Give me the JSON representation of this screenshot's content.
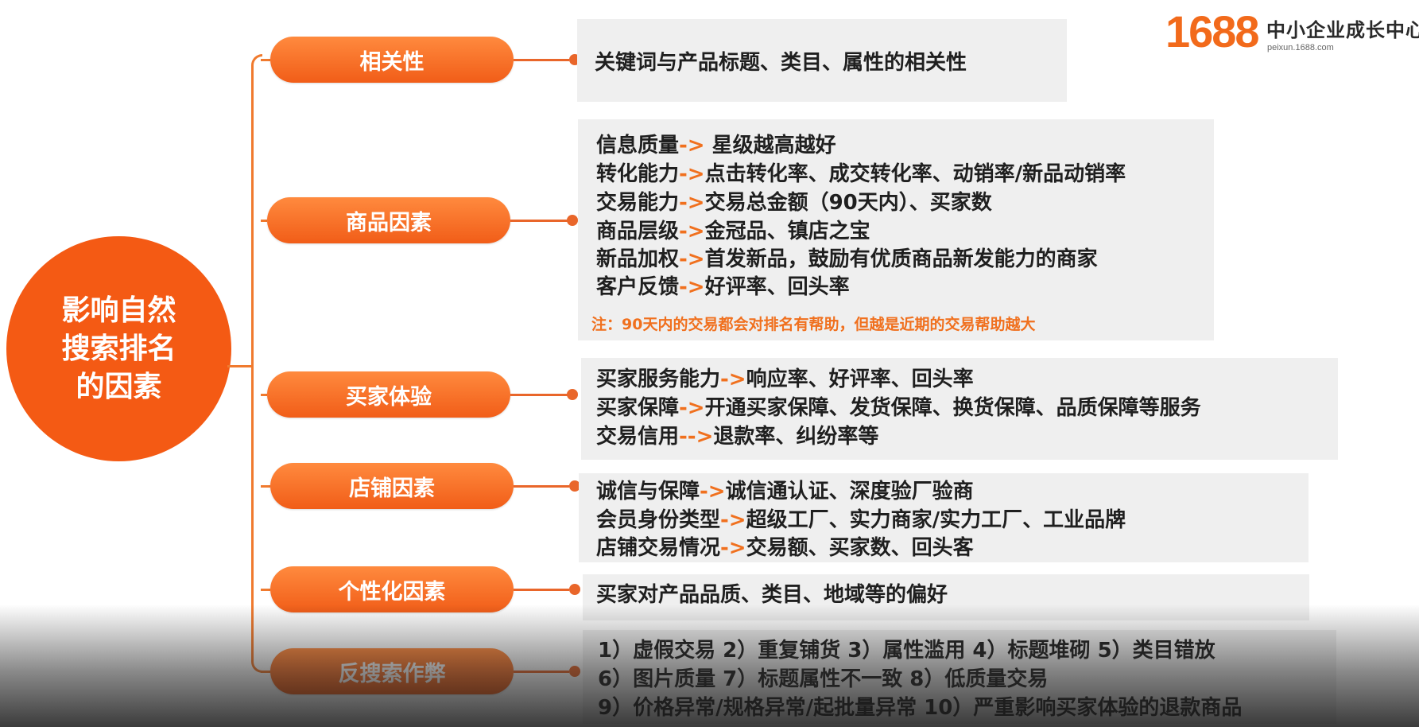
{
  "logo": {
    "number": "1688",
    "title": "中小企业成长中心",
    "url": "peixun.1688.com"
  },
  "colors": {
    "accent": "#f45a14",
    "arrow": "#f0701e",
    "box_bg": "#efefef"
  },
  "root": {
    "label": "影响自然搜索排名的因素"
  },
  "branches": [
    {
      "label": "相关性",
      "lines": [
        {
          "pre": "关键词与产品标题、类目、属性的相关性",
          "arrow": "",
          "post": ""
        }
      ]
    },
    {
      "label": "商品因素",
      "lines": [
        {
          "pre": "信息质量",
          "arrow": "-> ",
          "post": "星级越高越好"
        },
        {
          "pre": "转化能力",
          "arrow": "->",
          "post": "点击转化率、成交转化率、动销率/新品动销率"
        },
        {
          "pre": "交易能力",
          "arrow": "->",
          "post": "交易总金额（90天内）、买家数"
        },
        {
          "pre": "商品层级",
          "arrow": "->",
          "post": "金冠品、镇店之宝"
        },
        {
          "pre": "新品加权",
          "arrow": "->",
          "post": "首发新品，鼓励有优质商品新发能力的商家"
        },
        {
          "pre": "客户反馈",
          "arrow": "->",
          "post": "好评率、回头率"
        }
      ],
      "note": "注：90天内的交易都会对排名有帮助，但越是近期的交易帮助越大"
    },
    {
      "label": "买家体验",
      "lines": [
        {
          "pre": "买家服务能力",
          "arrow": "->",
          "post": "响应率、好评率、回头率"
        },
        {
          "pre": "买家保障",
          "arrow": "->",
          "post": "开通买家保障、发货保障、换货保障、品质保障等服务"
        },
        {
          "pre": "交易信用",
          "arrow": "-->",
          "post": "退款率、纠纷率等"
        }
      ]
    },
    {
      "label": "店铺因素",
      "lines": [
        {
          "pre": "诚信与保障",
          "arrow": "->",
          "post": "诚信通认证、深度验厂验商"
        },
        {
          "pre": "会员身份类型",
          "arrow": "->",
          "post": "超级工厂、实力商家/实力工厂、工业品牌"
        },
        {
          "pre": "店铺交易情况",
          "arrow": "->",
          "post": "交易额、买家数、回头客"
        }
      ]
    },
    {
      "label": "个性化因素",
      "lines": [
        {
          "pre": "买家对产品品质、类目、地域等的偏好",
          "arrow": "",
          "post": ""
        }
      ]
    },
    {
      "label": "反搜索作弊",
      "lines": [
        {
          "pre": "1）虚假交易 2）重复铺货 3）属性滥用 4）标题堆砌 5）类目错放",
          "arrow": "",
          "post": ""
        },
        {
          "pre": "6）图片质量 7）标题属性不一致 8）低质量交易",
          "arrow": "",
          "post": ""
        },
        {
          "pre": "9）价格异常/规格异常/起批量异常 10）严重影响买家体验的退款商品",
          "arrow": "",
          "post": ""
        }
      ]
    }
  ]
}
